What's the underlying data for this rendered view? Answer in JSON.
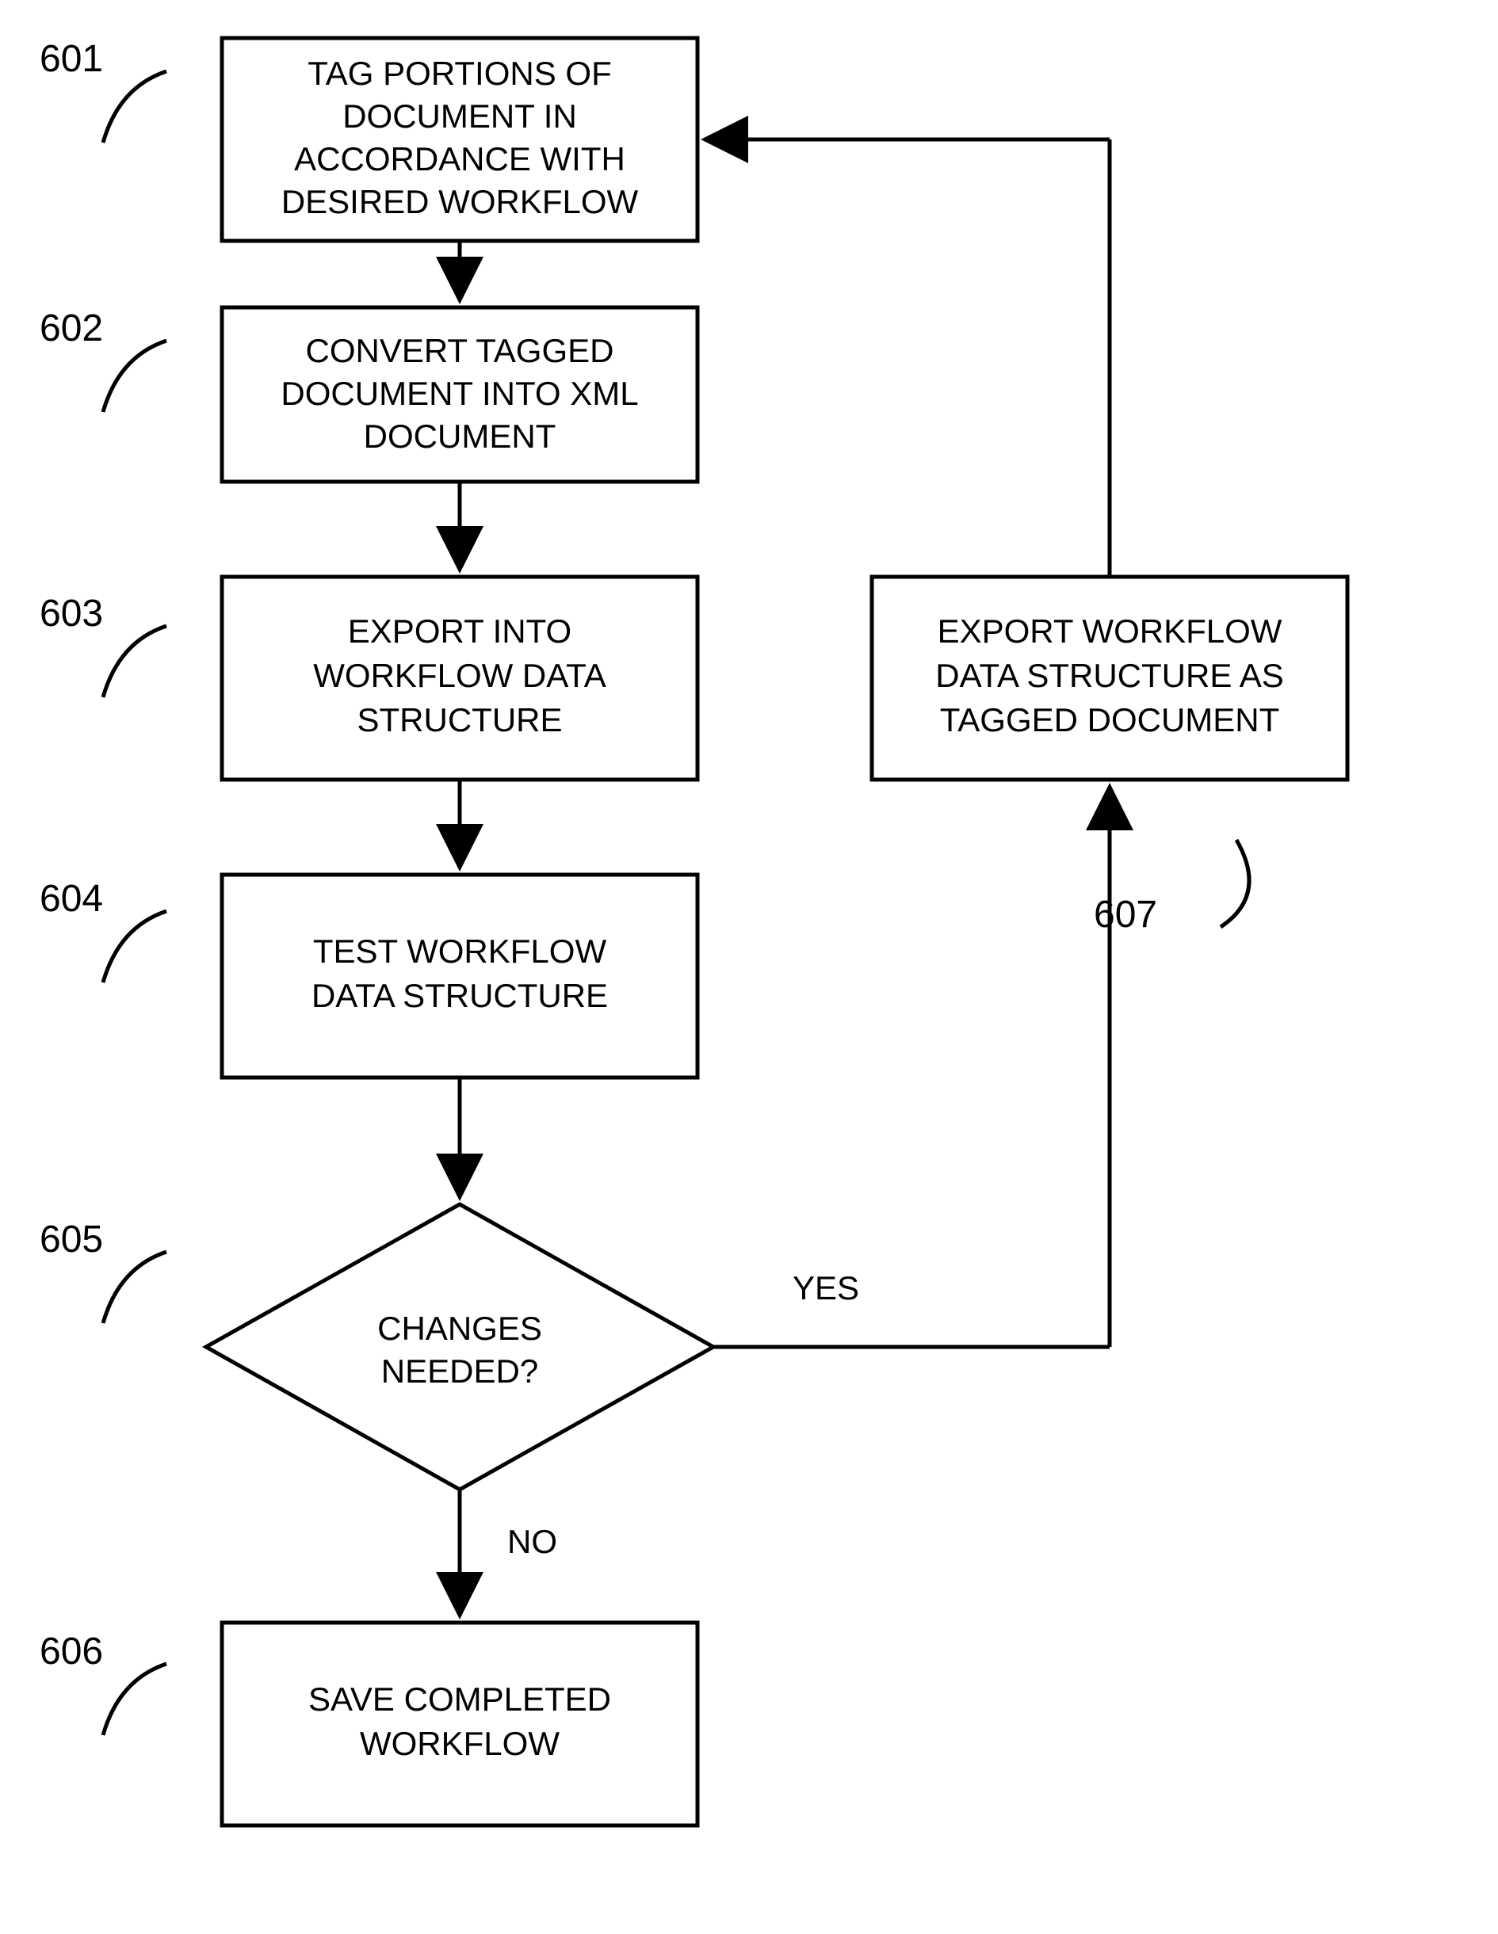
{
  "boxes": {
    "b601": {
      "label": "601",
      "lines": [
        "TAG PORTIONS OF",
        "DOCUMENT IN",
        "ACCORDANCE WITH",
        "DESIRED WORKFLOW"
      ]
    },
    "b602": {
      "label": "602",
      "lines": [
        "CONVERT TAGGED",
        "DOCUMENT INTO XML",
        "DOCUMENT"
      ]
    },
    "b603": {
      "label": "603",
      "lines": [
        "EXPORT INTO",
        "WORKFLOW DATA",
        "STRUCTURE"
      ]
    },
    "b604": {
      "label": "604",
      "lines": [
        "TEST WORKFLOW",
        "DATA STRUCTURE"
      ]
    },
    "b605": {
      "label": "605",
      "lines": [
        "CHANGES",
        "NEEDED?"
      ]
    },
    "b606": {
      "label": "606",
      "lines": [
        "SAVE COMPLETED",
        "WORKFLOW"
      ]
    },
    "b607": {
      "label": "607",
      "lines": [
        "EXPORT WORKFLOW",
        "DATA STRUCTURE AS",
        "TAGGED DOCUMENT"
      ]
    }
  },
  "edges": {
    "yes": "YES",
    "no": "NO"
  }
}
